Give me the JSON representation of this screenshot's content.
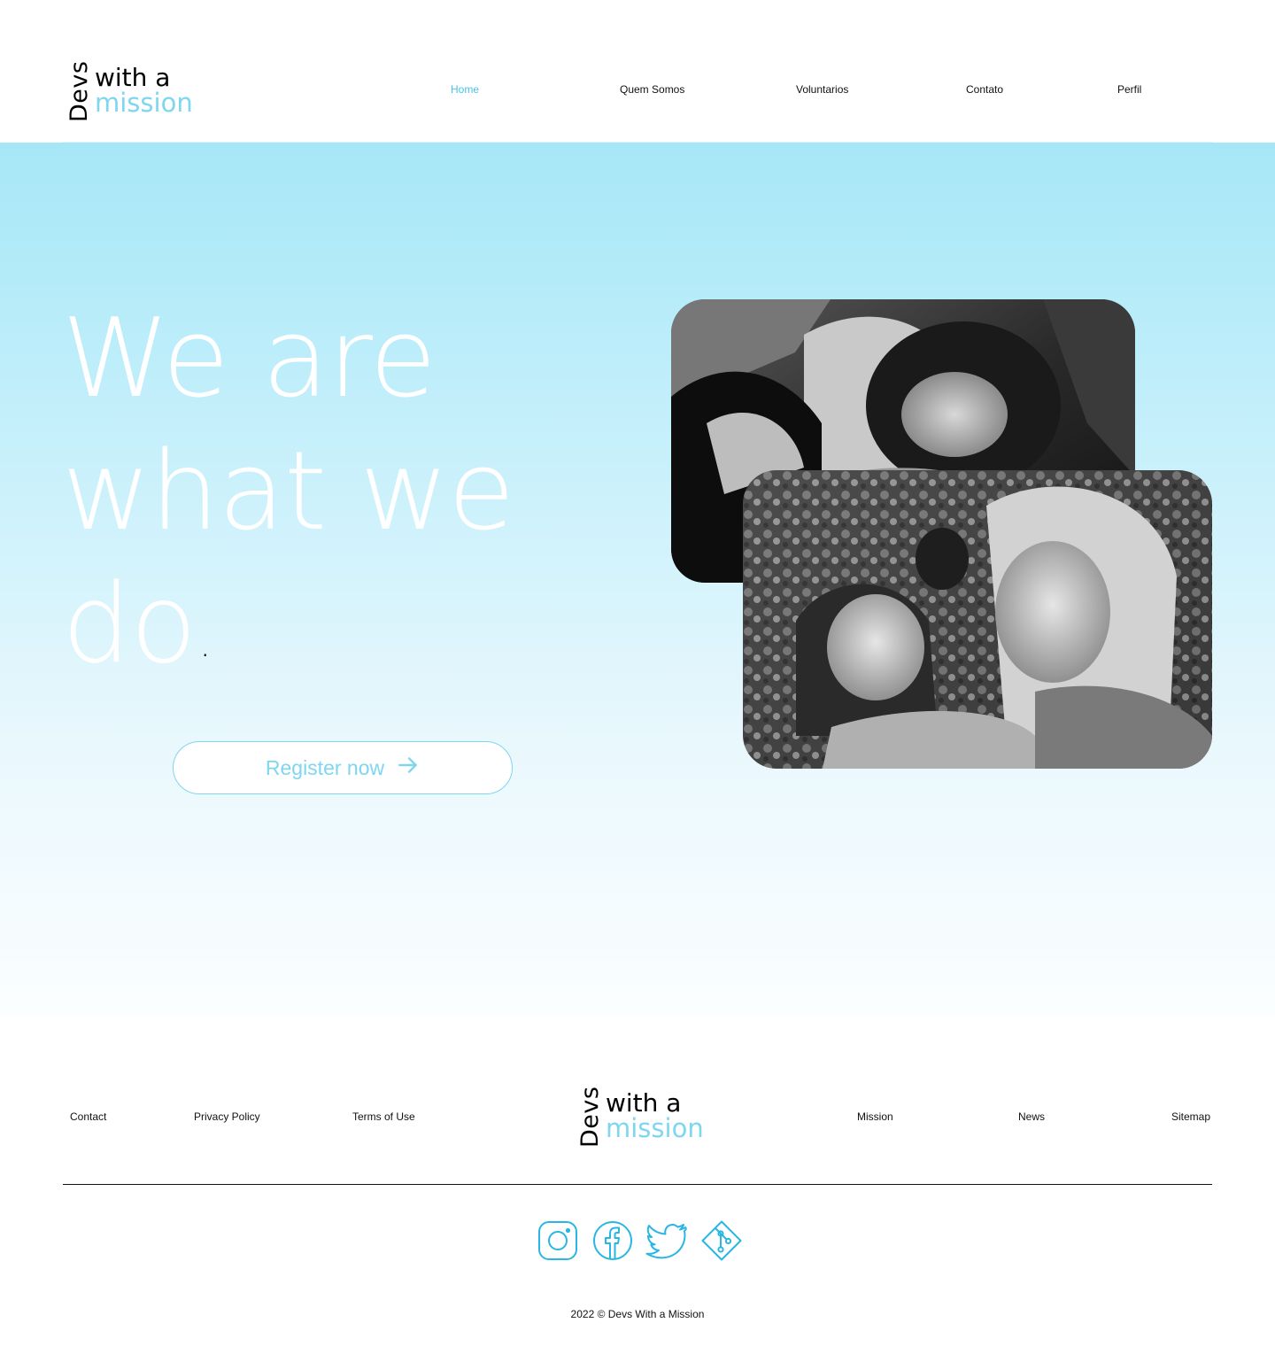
{
  "brand": {
    "devs": "Devs",
    "with_a": "with a",
    "mission": "mission",
    "accent_color": "#7ed6ef"
  },
  "nav": {
    "items": [
      {
        "label": "Home",
        "active": true
      },
      {
        "label": "Quem Somos"
      },
      {
        "label": "Voluntarios"
      },
      {
        "label": "Contato"
      },
      {
        "label": "Perfil"
      }
    ]
  },
  "hero": {
    "line1": "We are",
    "line2": "what we",
    "line3": "do",
    "dot": ".",
    "cta_label": "Register now",
    "cta_icon": "arrow-right-icon"
  },
  "footer": {
    "left_links": [
      "Contact",
      "Privacy Policy",
      "Terms of Use"
    ],
    "right_links": [
      "Mission",
      "News",
      "Sitemap"
    ],
    "social_icons": [
      "instagram-icon",
      "facebook-icon",
      "twitter-icon",
      "git-icon"
    ],
    "copyright": "2022 © Devs With a Mission"
  }
}
